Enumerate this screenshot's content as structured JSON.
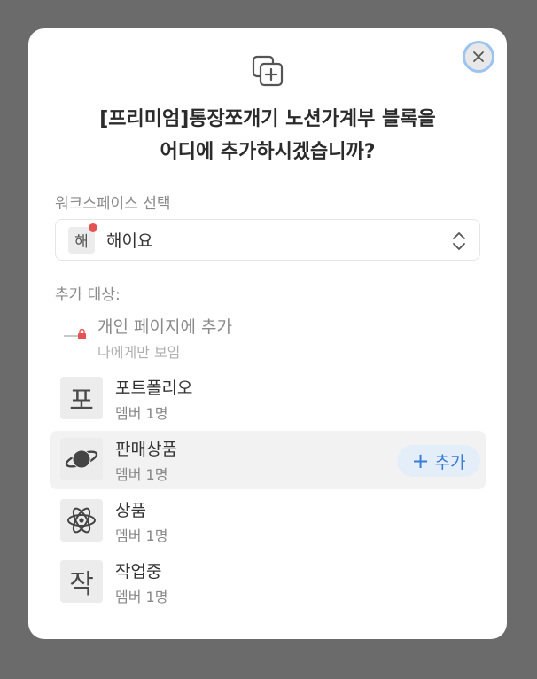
{
  "modal": {
    "title_line1": "[프리미엄]통장쪼개기 노션가계부 블록을",
    "title_line2": "어디에 추가하시겠습니까?"
  },
  "workspace": {
    "label": "워크스페이스 선택",
    "badge": "해",
    "name": "해이요",
    "has_notification_dot": true
  },
  "targets": {
    "label": "추가 대상:",
    "personal": {
      "title": "개인 페이지에 추가",
      "subtitle": "나에게만 보임",
      "icon": "lock-icon"
    },
    "items": [
      {
        "icon_text": "포",
        "icon": "text-icon",
        "title": "포트폴리오",
        "subtitle": "멤버 1명"
      },
      {
        "icon_text": "",
        "icon": "planet-icon",
        "title": "판매상품",
        "subtitle": "멤버 1명"
      },
      {
        "icon_text": "",
        "icon": "atom-icon",
        "title": "상품",
        "subtitle": "멤버 1명"
      },
      {
        "icon_text": "작",
        "icon": "text-icon",
        "title": "작업중",
        "subtitle": "멤버 1명"
      }
    ],
    "add_button": {
      "plus": "+",
      "label": "추가"
    }
  },
  "colors": {
    "overlay": "#6b6b6b",
    "accent": "#3a7bd5",
    "notification": "#e35353"
  }
}
